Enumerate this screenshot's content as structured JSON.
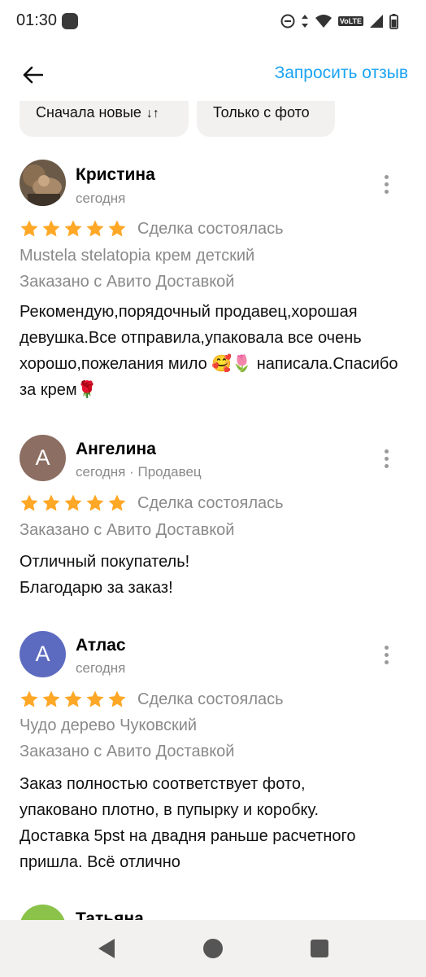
{
  "status": {
    "time": "01:30",
    "volte": "VoLTE"
  },
  "header": {
    "request_label": "Запросить отзыв"
  },
  "filters": {
    "sort_label": "Сначала новые",
    "photo_label": "Только с фото"
  },
  "reviews": [
    {
      "name": "Кристина",
      "meta": "сегодня",
      "status": "Сделка состоялась",
      "rating": 5,
      "product": "Mustela stelatopia крем детский",
      "delivery": "Заказано с Авито Доставкой",
      "text": "Рекомендую,порядочный продавец,хорошая девушка.Все отправила,упаковала все очень хорошо,пожелания мило 🥰🌷 написала.Спасибо за крем🌹"
    },
    {
      "name": "Ангелина",
      "initial": "А",
      "color": "#8d6e63",
      "meta": "сегодня · Продавец",
      "status": "Сделка состоялась",
      "rating": 5,
      "delivery": "Заказано с Авито Доставкой",
      "text_lines": [
        "Отличный покупатель!",
        "Благодарю за заказ!"
      ]
    },
    {
      "name": "Атлас",
      "initial": "А",
      "color": "#5c6bc0",
      "meta": "сегодня",
      "status": "Сделка состоялась",
      "rating": 5,
      "product": "Чудо дерево Чуковский",
      "delivery": "Заказано с Авито Доставкой",
      "text_lines": [
        "Заказ полностью соответствует фото,",
        "упаковано плотно, в пупырку и коробку.",
        "Доставка 5pst  на двадня раньше расчетного",
        "пришла. Всё отлично"
      ]
    },
    {
      "name": "Татьяна",
      "color": "#8bc34a"
    }
  ],
  "colors": {
    "accent": "#1aa3f3",
    "star": "#ffa726"
  }
}
